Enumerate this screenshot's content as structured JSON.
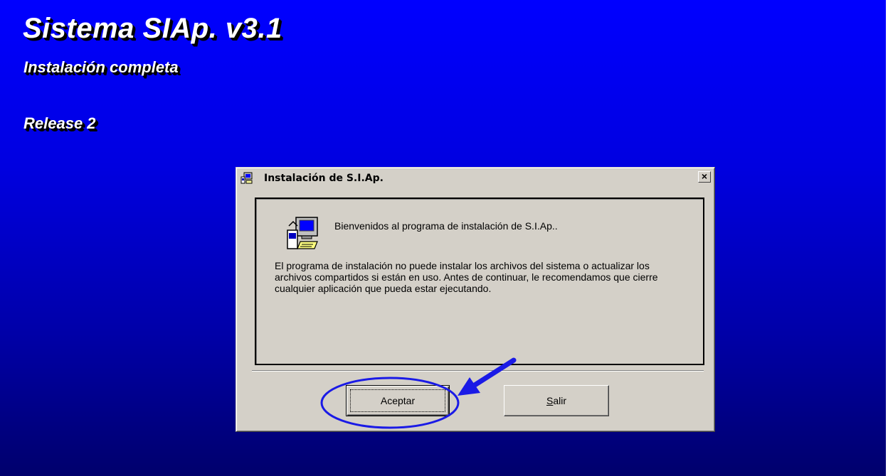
{
  "banner": {
    "app_title": "Sistema SIAp. v3.1",
    "subtitle": "Instalación completa",
    "release": "Release 2"
  },
  "dialog": {
    "title": "Instalación de S.I.Ap.",
    "close_label": "×",
    "welcome": "Bienvenidos al programa de instalación de S.I.Ap..",
    "body": "El programa de instalación no puede instalar los archivos del sistema o actualizar los archivos compartidos si están en uso. Antes de continuar, le recomendamos que cierre cualquier aplicación que pueda estar ejecutando.",
    "ok_button": "Aceptar",
    "exit_button_mnemonic": "S",
    "exit_button_rest": "alir"
  },
  "icons": {
    "title_icon": "setup-computer-icon",
    "setup_icon": "setup-computer-icon",
    "close_icon": "close-icon"
  },
  "colors": {
    "background_top": "#0000ff",
    "background_bottom": "#00006c",
    "dialog_face": "#d4d0c8",
    "annotation": "#1a1ae6"
  }
}
